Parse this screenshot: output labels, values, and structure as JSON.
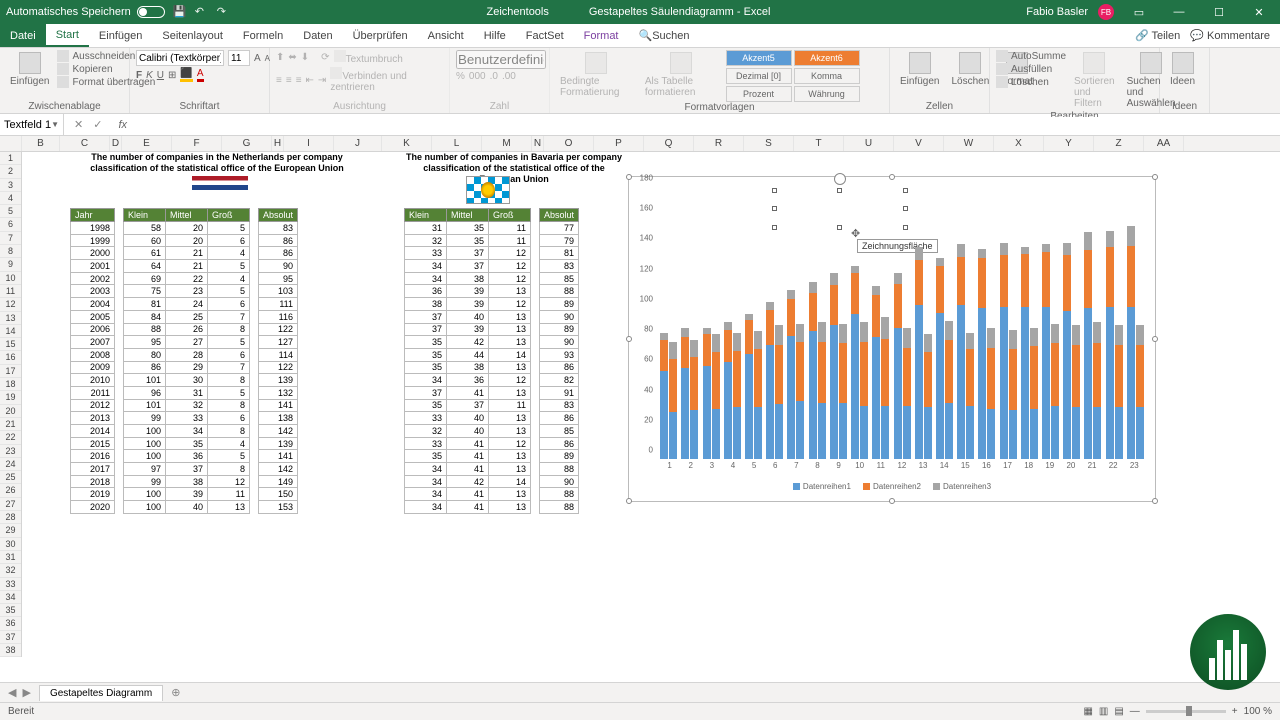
{
  "titlebar": {
    "autosave": "Automatisches Speichern",
    "tooltab": "Zeichentools",
    "docname": "Gestapeltes Säulendiagramm - Excel",
    "user": "Fabio Basler",
    "avatar": "FB"
  },
  "ribtabs": {
    "file": "Datei",
    "start": "Start",
    "einfuegen": "Einfügen",
    "seitenlayout": "Seitenlayout",
    "formeln": "Formeln",
    "daten": "Daten",
    "ueberpruefen": "Überprüfen",
    "ansicht": "Ansicht",
    "hilfe": "Hilfe",
    "factset": "FactSet",
    "format": "Format",
    "suchen": "Suchen",
    "teilen": "Teilen",
    "kommentare": "Kommentare"
  },
  "ribbon": {
    "paste": "Einfügen",
    "cut": "Ausschneiden",
    "copy": "Kopieren",
    "formatpaint": "Format übertragen",
    "clipboard": "Zwischenablage",
    "font": "Calibri (Textkörper)",
    "fontsize": "11",
    "fontgroup": "Schriftart",
    "wrap": "Textumbruch",
    "merge": "Verbinden und zentrieren",
    "aligngroup": "Ausrichtung",
    "numfmt": "Benutzerdefiniert",
    "numgroup": "Zahl",
    "condfmt": "Bedingte Formatierung",
    "astable": "Als Tabelle formatieren",
    "styles": {
      "a5": "Akzent5",
      "a6": "Akzent6",
      "d0": "Dezimal [0]",
      "komma": "Komma",
      "prozent": "Prozent",
      "waehrung": "Währung"
    },
    "stylegroup": "Formatvorlagen",
    "insert": "Einfügen",
    "delete": "Löschen",
    "format2": "Format",
    "cellgroup": "Zellen",
    "autosum": "AutoSumme",
    "fill": "Ausfüllen",
    "clear": "Löschen",
    "sort": "Sortieren und Filtern",
    "find": "Suchen und Auswählen",
    "editgroup": "Bearbeiten",
    "ideas": "Ideen"
  },
  "namebox": "Textfeld 1",
  "titles": {
    "nl": "The number of companies in the Netherlands per company classification of the statistical office of the European Union",
    "bv": "The number of companies in Bavaria per company classification of the statistical office of the European Union"
  },
  "headers": {
    "jahr": "Jahr",
    "klein": "Klein",
    "mittel": "Mittel",
    "gross": "Groß",
    "absolut": "Absolut"
  },
  "nl_years": [
    1998,
    1999,
    2000,
    2001,
    2002,
    2003,
    2004,
    2005,
    2006,
    2007,
    2008,
    2009,
    2010,
    2011,
    2012,
    2013,
    2014,
    2015,
    2016,
    2017,
    2018,
    2019,
    2020
  ],
  "nl": [
    [
      58,
      20,
      5,
      83
    ],
    [
      60,
      20,
      6,
      86
    ],
    [
      61,
      21,
      4,
      86
    ],
    [
      64,
      21,
      5,
      90
    ],
    [
      69,
      22,
      4,
      95
    ],
    [
      75,
      23,
      5,
      103
    ],
    [
      81,
      24,
      6,
      111
    ],
    [
      84,
      25,
      7,
      116
    ],
    [
      88,
      26,
      8,
      122
    ],
    [
      95,
      27,
      5,
      127
    ],
    [
      80,
      28,
      6,
      114
    ],
    [
      86,
      29,
      7,
      122
    ],
    [
      101,
      30,
      8,
      139
    ],
    [
      96,
      31,
      5,
      132
    ],
    [
      101,
      32,
      8,
      141
    ],
    [
      99,
      33,
      6,
      138
    ],
    [
      100,
      34,
      8,
      142
    ],
    [
      100,
      35,
      4,
      139
    ],
    [
      100,
      36,
      5,
      141
    ],
    [
      97,
      37,
      8,
      142
    ],
    [
      99,
      38,
      12,
      149
    ],
    [
      100,
      39,
      11,
      150
    ],
    [
      100,
      40,
      13,
      153
    ]
  ],
  "bv": [
    [
      31,
      35,
      11,
      77
    ],
    [
      32,
      35,
      11,
      79
    ],
    [
      33,
      37,
      12,
      81
    ],
    [
      34,
      37,
      12,
      83
    ],
    [
      34,
      38,
      12,
      85
    ],
    [
      36,
      39,
      13,
      88
    ],
    [
      38,
      39,
      12,
      89
    ],
    [
      37,
      40,
      13,
      90
    ],
    [
      37,
      39,
      13,
      89
    ],
    [
      35,
      42,
      13,
      90
    ],
    [
      35,
      44,
      14,
      93
    ],
    [
      35,
      38,
      13,
      86
    ],
    [
      34,
      36,
      12,
      82
    ],
    [
      37,
      41,
      13,
      91
    ],
    [
      35,
      37,
      11,
      83
    ],
    [
      33,
      40,
      13,
      86
    ],
    [
      32,
      40,
      13,
      85
    ],
    [
      33,
      41,
      12,
      86
    ],
    [
      35,
      41,
      13,
      89
    ],
    [
      34,
      41,
      13,
      88
    ],
    [
      34,
      42,
      14,
      90
    ],
    [
      34,
      41,
      13,
      88
    ],
    [
      34,
      41,
      13,
      88
    ]
  ],
  "chart_data": {
    "type": "bar",
    "stacked": true,
    "categories": [
      1,
      2,
      3,
      4,
      5,
      6,
      7,
      8,
      9,
      10,
      11,
      12,
      13,
      14,
      15,
      16,
      17,
      18,
      19,
      20,
      21,
      22,
      23
    ],
    "series_names": [
      "Datenreihen1",
      "Datenreihen2",
      "Datenreihen3"
    ],
    "ylim": [
      0,
      180
    ],
    "yticks": [
      0,
      20,
      40,
      60,
      80,
      100,
      120,
      140,
      160,
      180
    ],
    "tooltip": "Zeichnungsfläche",
    "nl_series": {
      "s1": [
        58,
        60,
        61,
        64,
        69,
        75,
        81,
        84,
        88,
        95,
        80,
        86,
        101,
        96,
        101,
        99,
        100,
        100,
        100,
        97,
        99,
        100,
        100
      ],
      "s2": [
        20,
        20,
        21,
        21,
        22,
        23,
        24,
        25,
        26,
        27,
        28,
        29,
        30,
        31,
        32,
        33,
        34,
        35,
        36,
        37,
        38,
        39,
        40
      ],
      "s3": [
        5,
        6,
        4,
        5,
        4,
        5,
        6,
        7,
        8,
        5,
        6,
        7,
        8,
        5,
        8,
        6,
        8,
        4,
        5,
        8,
        12,
        11,
        13
      ]
    },
    "bv_series": {
      "s1": [
        31,
        32,
        33,
        34,
        34,
        36,
        38,
        37,
        37,
        35,
        35,
        35,
        34,
        37,
        35,
        33,
        32,
        33,
        35,
        34,
        34,
        34,
        34
      ],
      "s2": [
        35,
        35,
        37,
        37,
        38,
        39,
        39,
        40,
        39,
        42,
        44,
        38,
        36,
        41,
        37,
        40,
        40,
        41,
        41,
        41,
        42,
        41,
        41
      ],
      "s3": [
        11,
        11,
        12,
        12,
        12,
        13,
        12,
        13,
        13,
        13,
        14,
        13,
        12,
        13,
        11,
        13,
        13,
        12,
        13,
        13,
        14,
        13,
        13
      ]
    }
  },
  "sheet": "Gestapeltes Diagramm",
  "status": {
    "ready": "Bereit",
    "zoom": "100 %"
  }
}
